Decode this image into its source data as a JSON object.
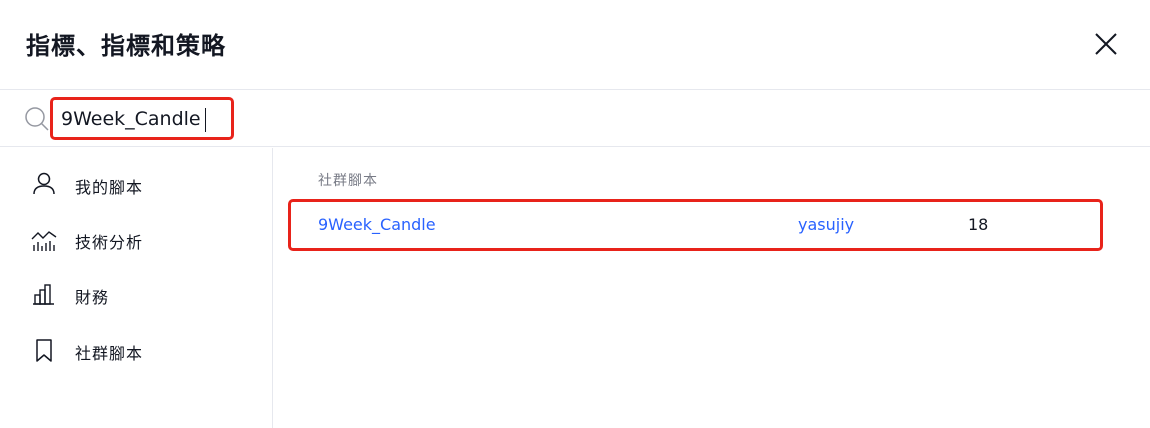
{
  "dialog": {
    "title": "指標、指標和策略",
    "close_icon": "close-icon"
  },
  "search": {
    "value": "9Week_Candle",
    "icon": "search-icon"
  },
  "sidebar": {
    "items": [
      {
        "label": "我的腳本",
        "icon": "user-icon"
      },
      {
        "label": "技術分析",
        "icon": "chart-icon"
      },
      {
        "label": "財務",
        "icon": "bar-chart-icon"
      },
      {
        "label": "社群腳本",
        "icon": "bookmark-icon"
      }
    ]
  },
  "results": {
    "section_label": "社群腳本",
    "rows": [
      {
        "name": "9Week_Candle",
        "author": "yasujiy",
        "count": "18"
      }
    ]
  },
  "colors": {
    "link": "#2962ff",
    "highlight": "#e8231a",
    "divider": "#e6e8ee"
  }
}
